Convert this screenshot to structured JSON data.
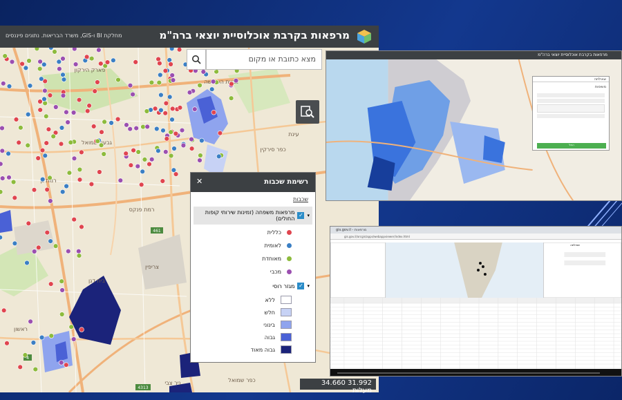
{
  "app": {
    "title": "מרפאות בקרבת אוכלוסיית יוצאי ברה\"מ",
    "subtitle": "מחלקת BI ו-GIS, משרד הבריאות. נתונים פיננסים"
  },
  "search": {
    "placeholder": "מצא כתובת או מקום"
  },
  "places": {
    "givat_hashlosha": "גבעת השלושה",
    "einat": "עינת",
    "kfar_sirkin": "כפר סירקין",
    "givat_shmuel": "גבעת שמואל",
    "ramat_gan": "רמת גן",
    "ramat_pinkas": "רמת פנקס",
    "beit_dagan": "בית דגן",
    "tzrifin": "צריפין",
    "rishon": "ראשון",
    "nir_tzvi": "ניר צבי",
    "kfar_shmuel": "כפר שמואל",
    "park_hayarkon": "פארק הירקון",
    "road_444": "444",
    "road_461": "461",
    "road_431": "4313",
    "road_4": "4"
  },
  "legend": {
    "title": "רשימת שכבות",
    "tab": "שכבות",
    "layer1": "מרפאות משפחה (זמינות שירותי קופות החולים)",
    "items": [
      {
        "label": "כללית",
        "color": "#e0454f"
      },
      {
        "label": "לאומית",
        "color": "#3b7fc4"
      },
      {
        "label": "מאוחדת",
        "color": "#8dbb3c"
      },
      {
        "label": "מכבי",
        "color": "#9b4fb0"
      }
    ],
    "layer2": "מגזר רוסי",
    "classes": [
      {
        "label": "ללא",
        "color": "#ffffff"
      },
      {
        "label": "חלש",
        "color": "#c7d2f5"
      },
      {
        "label": "בינוני",
        "color": "#8fa4ee"
      },
      {
        "label": "גבוה",
        "color": "#4a61d6"
      },
      {
        "label": "גבוה מאוד",
        "color": "#1b237a"
      }
    ]
  },
  "scale": {
    "text": "31.992  34.660  מעלות"
  },
  "win2": {
    "title": "מרפאות בקרבת אוכלוסיית יוצאי ברה\"מ",
    "panel_title": "שאילתה",
    "panel_tab": "משימות",
    "apply": "החל"
  },
  "win3": {
    "tab": "gis.gov.il - מרפאות",
    "url": "gis.gov.il/arcgis/apps/webappviewer/index.html",
    "panel_title": "שאילתה"
  },
  "colors": {
    "clalit": "#e0454f",
    "leumit": "#3b7fc4",
    "meuhedet": "#8dbb3c",
    "maccabi": "#9b4fb0"
  }
}
